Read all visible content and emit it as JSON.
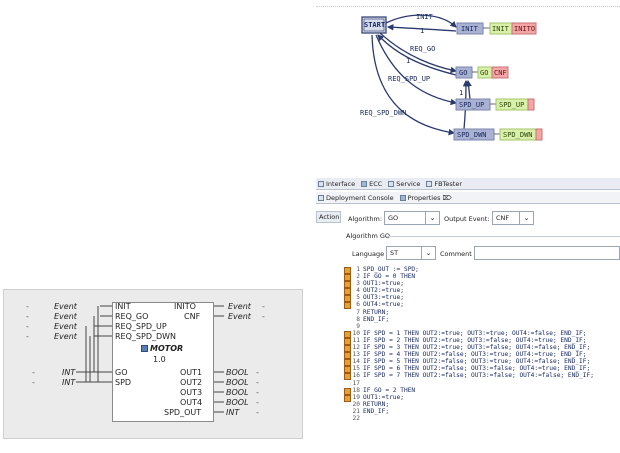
{
  "fb_interface": {
    "inputs": [
      {
        "type": "Event",
        "name": "INIT"
      },
      {
        "type": "Event",
        "name": "REQ_GO"
      },
      {
        "type": "Event",
        "name": "REQ_SPD_UP"
      },
      {
        "type": "Event",
        "name": "REQ_SPD_DWN"
      },
      {
        "type": "INT",
        "name": "GO"
      },
      {
        "type": "INT",
        "name": "SPD"
      }
    ],
    "outputs": [
      {
        "name": "INITO",
        "type": "Event"
      },
      {
        "name": "CNF",
        "type": "Event"
      },
      {
        "name": "OUT1",
        "type": "BOOL"
      },
      {
        "name": "OUT2",
        "type": "BOOL"
      },
      {
        "name": "OUT3",
        "type": "BOOL"
      },
      {
        "name": "OUT4",
        "type": "BOOL"
      },
      {
        "name": "SPD_OUT",
        "type": "INT"
      }
    ],
    "fb_name": "MOTOR",
    "version": "1.0",
    "dash": "-"
  },
  "ecc": {
    "start_state": "START",
    "states": [
      {
        "name": "INIT",
        "algorithm": "INIT",
        "event": "INITO"
      },
      {
        "name": "GO",
        "algorithm": "GO",
        "event": "CNF"
      },
      {
        "name": "SPD_UP",
        "algorithm": "SPD_UP",
        "event": ""
      },
      {
        "name": "SPD_DWN",
        "algorithm": "SPD_DWN",
        "event": ""
      }
    ],
    "transitions": [
      {
        "label": "INIT"
      },
      {
        "label": "1"
      },
      {
        "label": "REQ_GO"
      },
      {
        "label": "1"
      },
      {
        "label": "REQ_SPD_UP"
      },
      {
        "label": "1"
      },
      {
        "label": "REQ_SPD_DWN"
      }
    ]
  },
  "tabs": {
    "row1": [
      "Interface",
      "ECC",
      "Service",
      "FBTester"
    ],
    "row2": [
      "Deployment Console",
      "Properties ⌦"
    ]
  },
  "properties": {
    "side_tab": "Action",
    "algorithm_label": "Algorithm:",
    "algorithm_value": "GO",
    "output_event_label": "Output Event:",
    "output_event_value": "CNF",
    "group_title": "Algorithm GO",
    "language_label": "Language",
    "language_value": "ST",
    "comment_label": "Comment",
    "comment_value": ""
  },
  "code_lines": [
    {
      "n": "1",
      "mark": true,
      "text": "SPD_OUT := SPD;"
    },
    {
      "n": "2",
      "mark": true,
      "text": "IF GO = 0 THEN"
    },
    {
      "n": "3",
      "mark": true,
      "text": "   OUT1:=true;"
    },
    {
      "n": "4",
      "mark": true,
      "text": "   OUT2:=true;"
    },
    {
      "n": "5",
      "mark": true,
      "text": "   OUT3:=true;"
    },
    {
      "n": "6",
      "mark": true,
      "text": "   OUT4:=true;"
    },
    {
      "n": "7",
      "mark": false,
      "text": "   RETURN;"
    },
    {
      "n": "8",
      "mark": false,
      "text": "END_IF;"
    },
    {
      "n": "9",
      "mark": false,
      "text": ""
    },
    {
      "n": "10",
      "mark": true,
      "text": "IF SPD = 1 THEN  OUT2:=true;  OUT3:=true;  OUT4:=false; END_IF;"
    },
    {
      "n": "11",
      "mark": true,
      "text": "IF SPD = 2 THEN  OUT2:=true;  OUT3:=false; OUT4:=true; END_IF;"
    },
    {
      "n": "12",
      "mark": true,
      "text": "IF SPD = 3 THEN  OUT2:=true;  OUT3:=false; OUT4:=false; END_IF;"
    },
    {
      "n": "13",
      "mark": true,
      "text": "IF SPD = 4 THEN  OUT2:=false; OUT3:=true;  OUT4:=true; END_IF;"
    },
    {
      "n": "14",
      "mark": true,
      "text": "IF SPD = 5 THEN  OUT2:=false; OUT3:=true;  OUT4:=false; END_IF;"
    },
    {
      "n": "15",
      "mark": true,
      "text": "IF SPD = 6 THEN  OUT2:=false; OUT3:=false; OUT4:=true; END_IF;"
    },
    {
      "n": "16",
      "mark": true,
      "text": "IF SPD = 7 THEN  OUT2:=false; OUT3:=false; OUT4:=false; END_IF;"
    },
    {
      "n": "17",
      "mark": false,
      "text": ""
    },
    {
      "n": "18",
      "mark": true,
      "text": "IF GO = 2 THEN"
    },
    {
      "n": "19",
      "mark": true,
      "text": "   OUT1:=true;"
    },
    {
      "n": "20",
      "mark": false,
      "text": "   RETURN;"
    },
    {
      "n": "21",
      "mark": false,
      "text": "END_IF;"
    },
    {
      "n": "22",
      "mark": false,
      "text": ""
    }
  ],
  "colors": {
    "state_fill": "#aab2d3",
    "algorithm_fill": "#d8f0a8",
    "event_fill": "#f4a6a6",
    "link": "#2a3a6e"
  }
}
